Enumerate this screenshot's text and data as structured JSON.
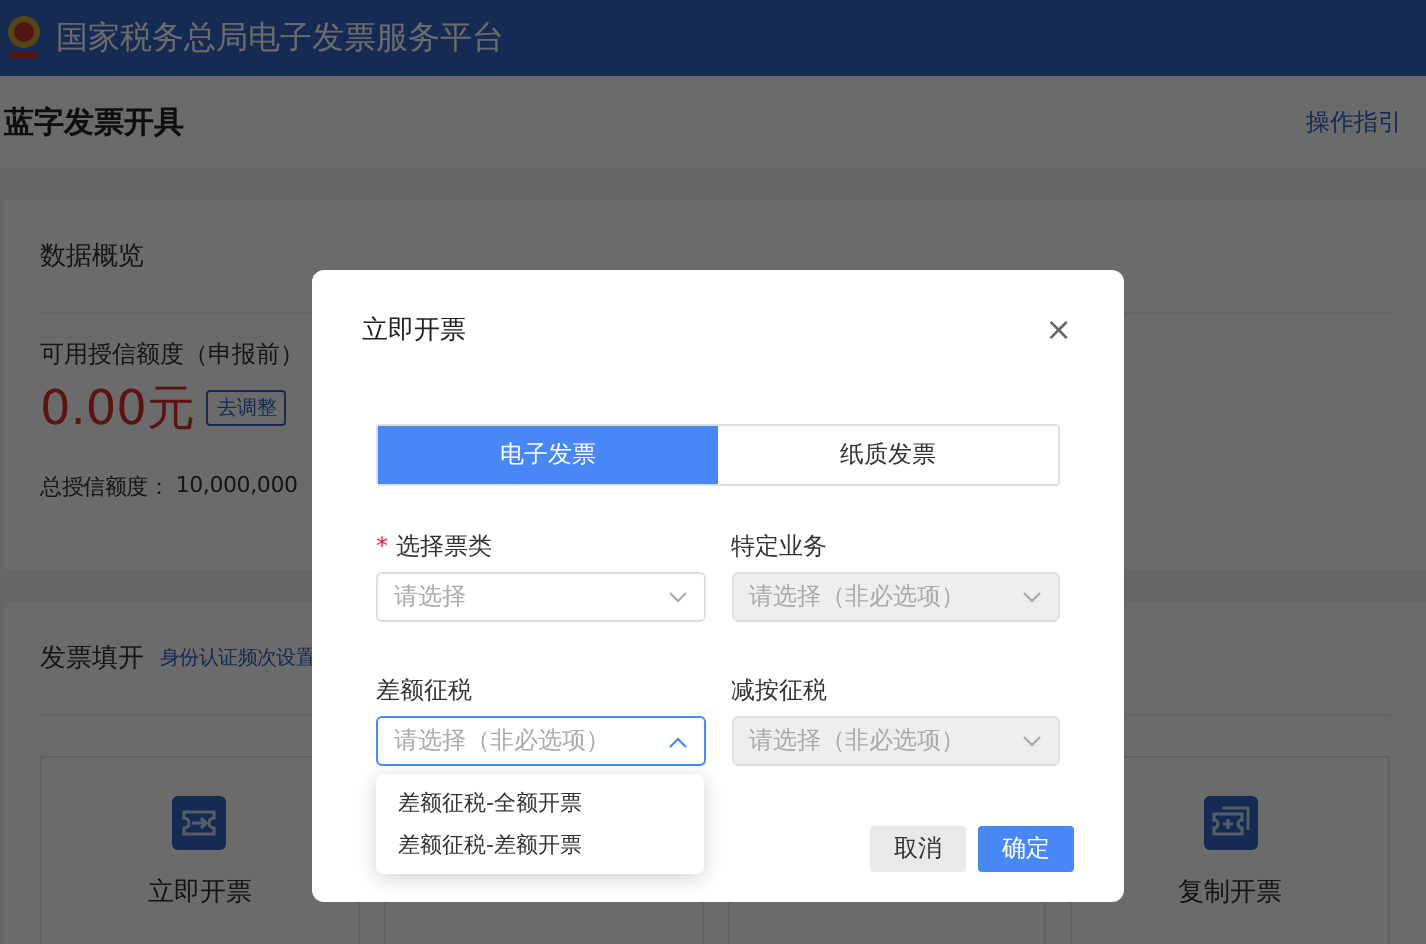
{
  "header": {
    "title": "国家税务总局电子发票服务平台"
  },
  "page": {
    "title": "蓝字发票开具",
    "guide_link": "操作指引"
  },
  "overview": {
    "title": "数据概览",
    "available_label": "可用授信额度（申报前）",
    "available_amount": "0.00元",
    "adjust_button": "去调整",
    "total_label": "总授信额度：",
    "total_value": "10,000,000"
  },
  "issue": {
    "title": "发票填开",
    "link": "身份认证频次设置",
    "tiles": [
      {
        "kind": "arrow",
        "label": "立即开票"
      },
      {
        "kind": "blank"
      },
      {
        "kind": "blank"
      },
      {
        "kind": "plus",
        "label": "复制开票"
      }
    ]
  },
  "dialog": {
    "title": "立即开票",
    "close": "×",
    "tabs": [
      {
        "label": "电子发票",
        "selected": true
      },
      {
        "label": "纸质发票",
        "selected": false
      }
    ],
    "fields": [
      {
        "required_mark": "*",
        "label": "选择票类",
        "placeholder": "请选择",
        "disabled": false,
        "expanded": false
      },
      {
        "label": "特定业务",
        "placeholder": "请选择（非必选项）",
        "disabled": true,
        "expanded": false
      },
      {
        "label": "差额征税",
        "placeholder": "请选择（非必选项）",
        "disabled": false,
        "expanded": true,
        "options": [
          "差额征税-全额开票",
          "差额征税-差额开票"
        ]
      },
      {
        "label": "减按征税",
        "placeholder": "请选择（非必选项）",
        "disabled": true,
        "expanded": false
      }
    ],
    "buttons": [
      {
        "label": "取消",
        "kind": "secondary"
      },
      {
        "label": "确定",
        "kind": "primary"
      }
    ]
  }
}
